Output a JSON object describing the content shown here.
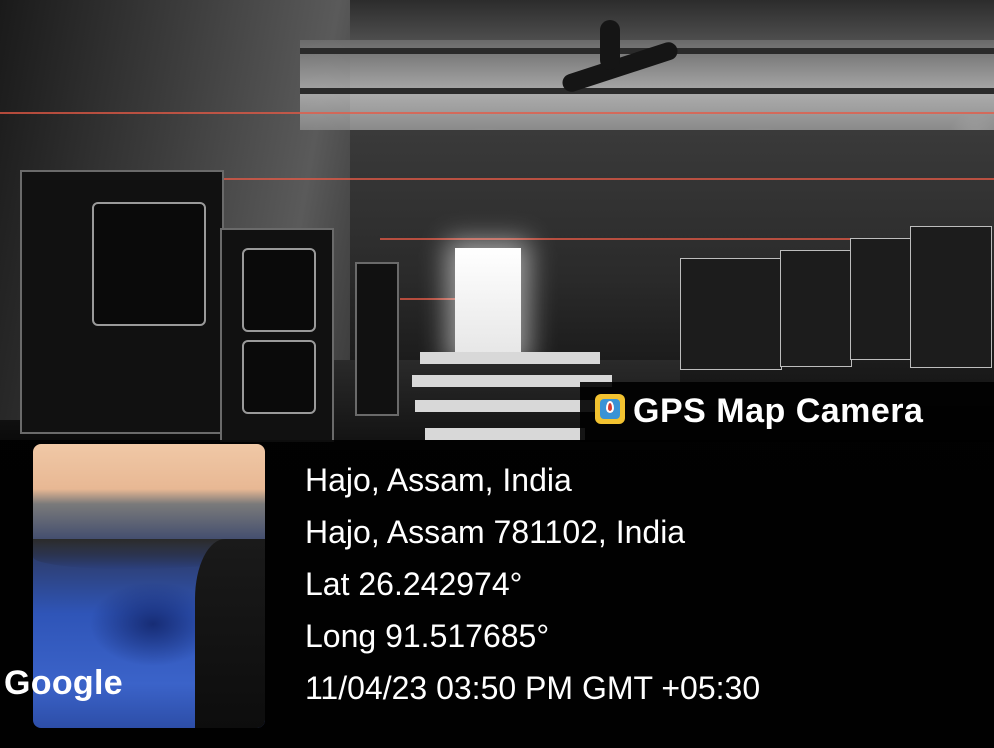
{
  "overlay": {
    "app_badge_label": "GPS Map Camera",
    "app_badge_icon": "map-pin-app-icon",
    "map_provider_label": "Google",
    "location_title": "Hajo, Assam, India",
    "address": "Hajo, Assam 781102, India",
    "latitude": "Lat 26.242974°",
    "longitude": "Long 91.517685°",
    "timestamp": "11/04/23 03:50 PM GMT +05:30"
  }
}
